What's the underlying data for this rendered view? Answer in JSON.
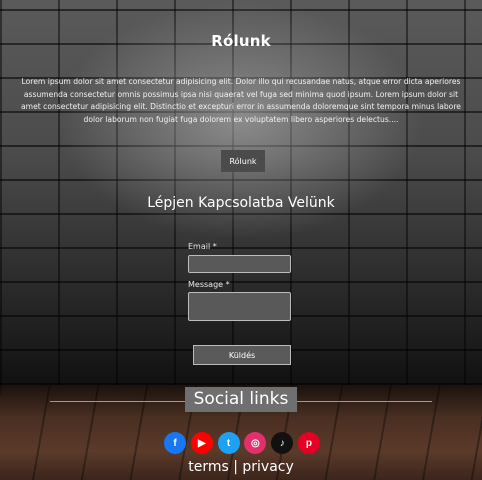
{
  "about": {
    "title": "Rólunk",
    "text": "Lorem ipsum dolor sit amet consectetur adipisicing elit. Dolor illo qui recusandae natus, atque error dicta aperiores assumenda consectetur omnis possimus ipsa nisi quaerat vel fuga sed minima quod ipsum. Lorem ipsum dolor sit amet consectetur adipisicing elit. Distinctio et excepturi error in assumenda doloremque sint tempora minus labore dolor laborum non fugiat fuga dolorem ex voluptatem libero asperiores delectus....",
    "button_label": "Rólunk"
  },
  "contact": {
    "title": "Lépjen Kapcsolatba Velünk",
    "email_label": "Email *",
    "email_value": "",
    "message_label": "Message *",
    "message_value": "",
    "submit_label": "Küldés"
  },
  "social": {
    "title": "Social links",
    "icons": [
      {
        "name": "facebook-icon",
        "glyph": "f",
        "color": "#1877f2"
      },
      {
        "name": "youtube-icon",
        "glyph": "▶",
        "color": "#ff0000"
      },
      {
        "name": "twitter-icon",
        "glyph": "t",
        "color": "#1da1f2"
      },
      {
        "name": "instagram-icon",
        "glyph": "◎",
        "color": "#e1306c"
      },
      {
        "name": "tiktok-icon",
        "glyph": "♪",
        "color": "#111111"
      },
      {
        "name": "pinterest-icon",
        "glyph": "p",
        "color": "#e60023"
      }
    ]
  },
  "footer": {
    "terms_label": "terms",
    "separator": "|",
    "privacy_label": "privacy"
  }
}
